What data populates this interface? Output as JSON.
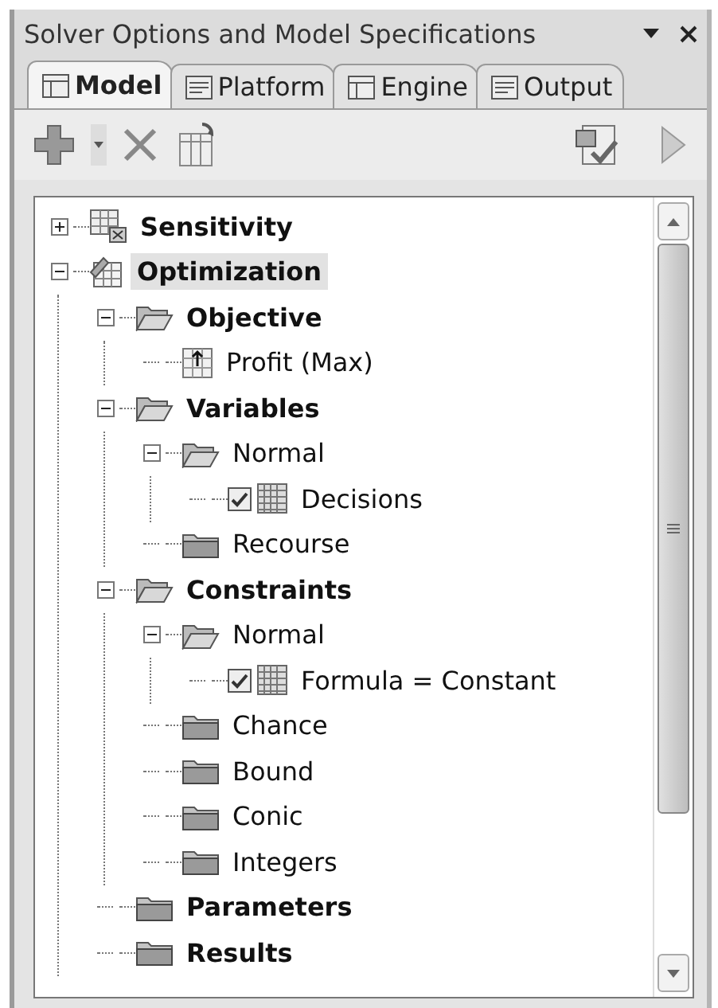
{
  "window": {
    "title": "Solver Options and Model Specifications"
  },
  "tabs": [
    {
      "label": "Model",
      "selected": true
    },
    {
      "label": "Platform",
      "selected": false
    },
    {
      "label": "Engine",
      "selected": false
    },
    {
      "label": "Output",
      "selected": false
    }
  ],
  "tree": [
    {
      "label": "Sensitivity",
      "kind": "sensitivity",
      "expanded": false,
      "selected": false
    },
    {
      "label": "Optimization",
      "kind": "model",
      "expanded": true,
      "selected": true,
      "children": [
        {
          "label": "Objective",
          "kind": "folder",
          "expanded": true,
          "selected": false,
          "children": [
            {
              "label": "Profit (Max)",
              "kind": "objective",
              "selected": false
            }
          ]
        },
        {
          "label": "Variables",
          "kind": "folder",
          "expanded": true,
          "selected": false,
          "children": [
            {
              "label": "Normal",
              "kind": "folder",
              "expanded": true,
              "selected": false,
              "children": [
                {
                  "label": "Decisions",
                  "kind": "cells",
                  "checked": true,
                  "selected": false
                }
              ]
            },
            {
              "label": "Recourse",
              "kind": "folder",
              "selected": false
            }
          ]
        },
        {
          "label": "Constraints",
          "kind": "folder",
          "expanded": true,
          "selected": false,
          "children": [
            {
              "label": "Normal",
              "kind": "folder",
              "expanded": true,
              "selected": false,
              "children": [
                {
                  "label": "Formula = Constant",
                  "kind": "cells",
                  "checked": true,
                  "selected": false
                }
              ]
            },
            {
              "label": "Chance",
              "kind": "folder",
              "selected": false
            },
            {
              "label": "Bound",
              "kind": "folder",
              "selected": false
            },
            {
              "label": "Conic",
              "kind": "folder",
              "selected": false
            },
            {
              "label": "Integers",
              "kind": "folder",
              "selected": false
            }
          ]
        },
        {
          "label": "Parameters",
          "kind": "folder",
          "selected": false
        },
        {
          "label": "Results",
          "kind": "folder",
          "selected": false
        }
      ]
    }
  ]
}
